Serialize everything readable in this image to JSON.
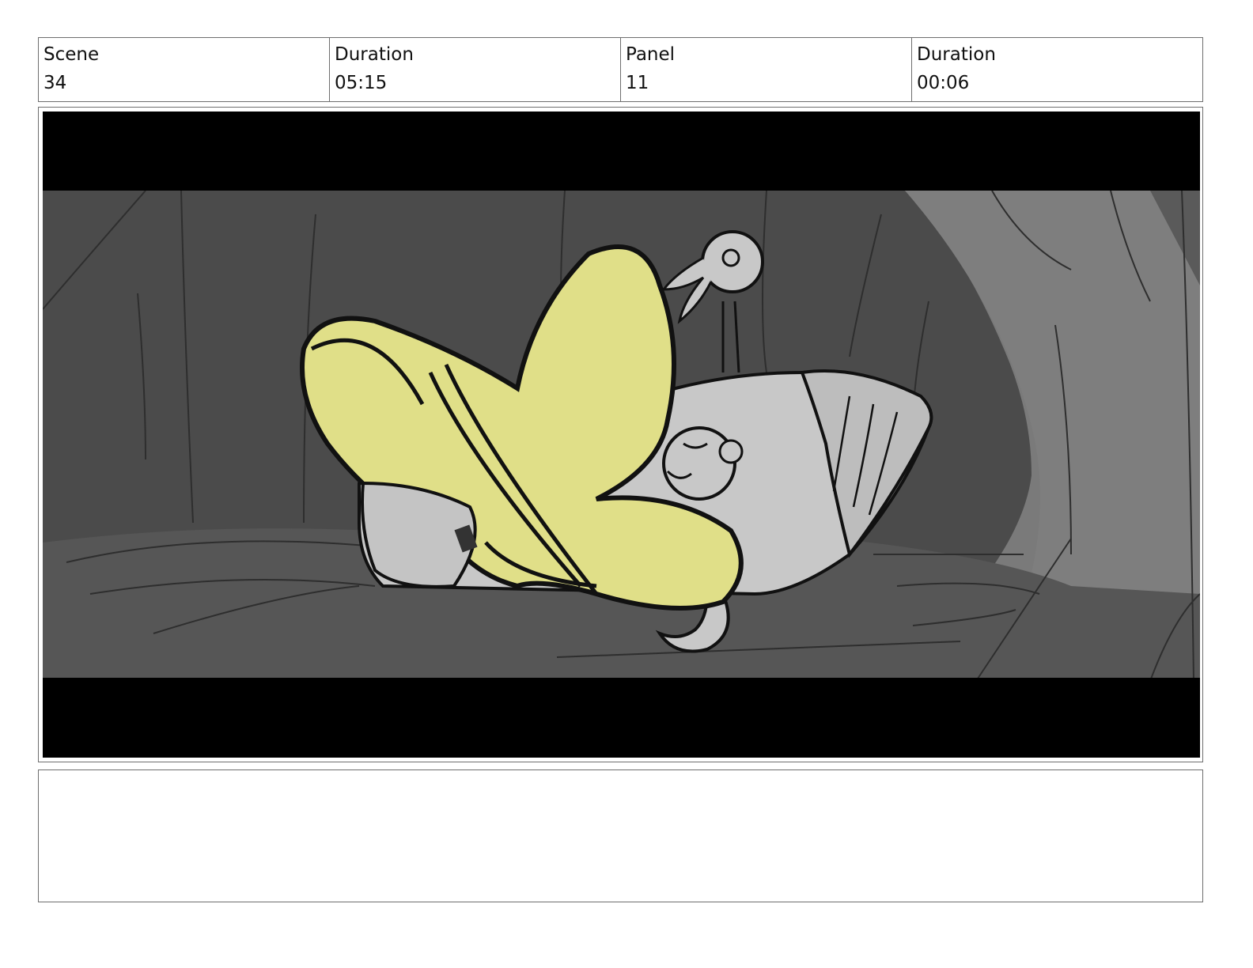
{
  "header": {
    "cells": [
      {
        "label": "Scene",
        "value": "34"
      },
      {
        "label": "Duration",
        "value": "05:15"
      },
      {
        "label": "Panel",
        "value": "11"
      },
      {
        "label": "Duration",
        "value": "00:06"
      }
    ]
  },
  "panel": {
    "colors": {
      "letterbox": "#000000",
      "cave_dark": "#4a4a4a",
      "cave_light": "#7a7a7a",
      "hat_yellow": "#e0df88",
      "character_gray": "#c8c8c8",
      "line": "#111111"
    }
  },
  "notes": {
    "text": ""
  }
}
